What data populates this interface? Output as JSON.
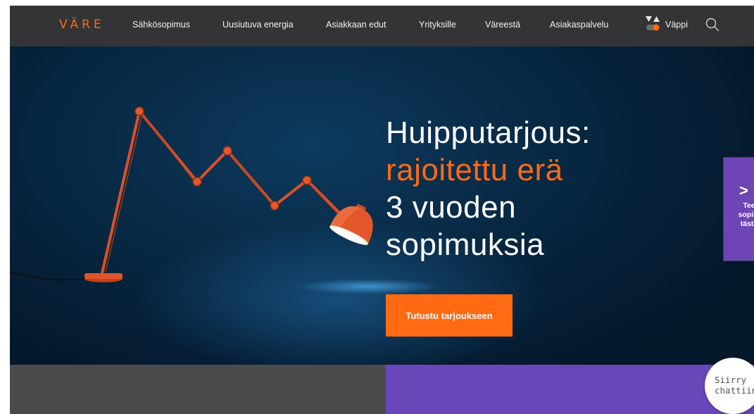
{
  "brand": {
    "logo_text": "VÄRE",
    "accent_color": "#ff6a13",
    "nav_bg": "#333435"
  },
  "nav": {
    "items": [
      {
        "label": "Sähkösopimus"
      },
      {
        "label": "Uusiutuva energia"
      },
      {
        "label": "Asiakkaan edut"
      },
      {
        "label": "Yrityksille"
      },
      {
        "label": "Väreestä"
      },
      {
        "label": "Asiakaspalvelu"
      }
    ],
    "vappi_label": "Väppi",
    "search_icon": "search-icon"
  },
  "hero": {
    "headline_line1": "Huipputarjous:",
    "headline_line2": "rajoitettu erä",
    "headline_line3": "3 vuoden",
    "headline_line4": "sopimuksia",
    "cta_label": "Tutustu tarjoukseen",
    "image": "orange-desk-lamp"
  },
  "side_tab": {
    "chevron": ">",
    "line1": "Tee",
    "line2": "sopim",
    "line3": "tästä",
    "color": "#6d45b4"
  },
  "chat": {
    "line1": "Siirry",
    "line2": "chattiin"
  },
  "bottom": {
    "left_color": "#4b4b4b",
    "right_color": "#6a47b8"
  }
}
